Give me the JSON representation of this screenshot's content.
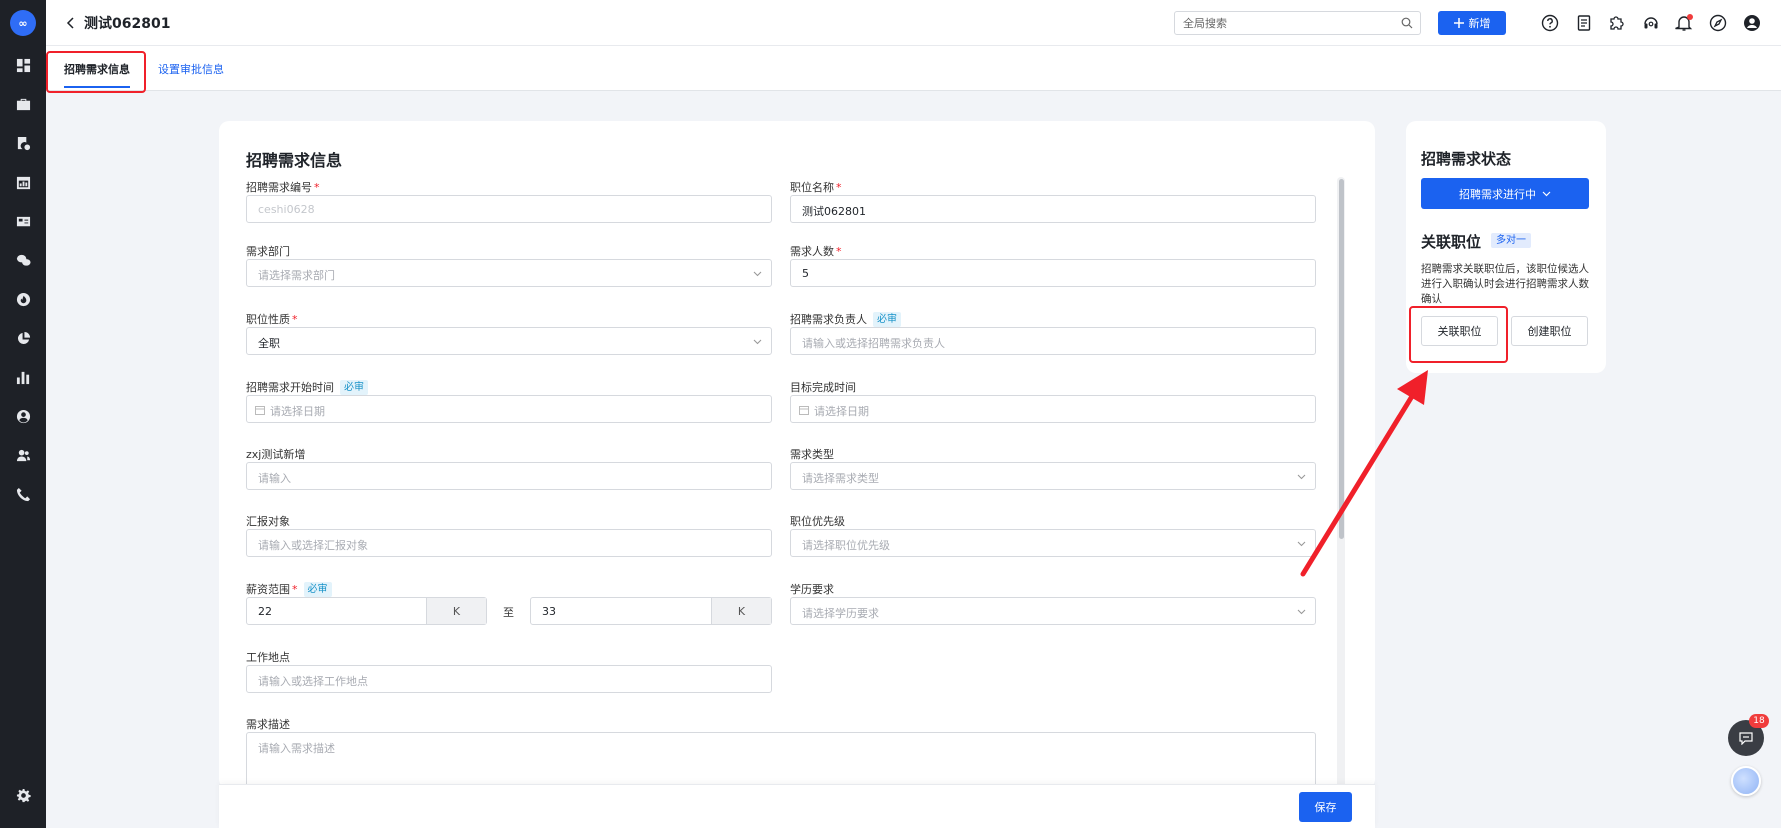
{
  "app": {
    "logo_text": "∞"
  },
  "header": {
    "title": "测试062801",
    "search_placeholder": "全局搜索",
    "add_label": "新增"
  },
  "tabs": [
    {
      "label": "招聘需求信息",
      "active": true
    },
    {
      "label": "设置审批信息",
      "active": false
    }
  ],
  "form": {
    "title": "招聘需求信息",
    "required_tag": "必审",
    "salary_to": "至",
    "fields": {
      "req_no": {
        "label": "招聘需求编号",
        "placeholder": "ceshi0628"
      },
      "job_title": {
        "label": "职位名称",
        "value": "测试062801"
      },
      "dept": {
        "label": "需求部门",
        "placeholder": "请选择需求部门"
      },
      "headcount": {
        "label": "需求人数",
        "value": "5"
      },
      "job_nature": {
        "label": "职位性质",
        "value": "全职"
      },
      "owner": {
        "label": "招聘需求负责人",
        "placeholder": "请输入或选择招聘需求负责人"
      },
      "start_time": {
        "label": "招聘需求开始时间",
        "placeholder": "请选择日期"
      },
      "target_time": {
        "label": "目标完成时间",
        "placeholder": "请选择日期"
      },
      "zxj": {
        "label": "zxj测试新增",
        "placeholder": "请输入"
      },
      "req_type": {
        "label": "需求类型",
        "placeholder": "请选择需求类型"
      },
      "report_to": {
        "label": "汇报对象",
        "placeholder": "请输入或选择汇报对象"
      },
      "priority": {
        "label": "职位优先级",
        "placeholder": "请选择职位优先级"
      },
      "salary": {
        "label": "薪资范围",
        "min": "22",
        "max": "33",
        "unit": "K"
      },
      "education": {
        "label": "学历要求",
        "placeholder": "请选择学历要求"
      },
      "location": {
        "label": "工作地点",
        "placeholder": "请输入或选择工作地点"
      },
      "description": {
        "label": "需求描述",
        "placeholder": "请输入需求描述"
      }
    },
    "save_label": "保存"
  },
  "side": {
    "status_title": "招聘需求状态",
    "status_value": "招聘需求进行中",
    "link_title": "关联职位",
    "link_tag": "多对一",
    "link_desc": "招聘需求关联职位后，该职位候选人进行入职确认时会进行招聘需求人数确认",
    "link_button": "关联职位",
    "create_button": "创建职位"
  },
  "float": {
    "chat_badge": "18"
  },
  "colors": {
    "primary": "#1b62f0",
    "annotation_red": "#f0202a",
    "rail": "#1e2127"
  }
}
